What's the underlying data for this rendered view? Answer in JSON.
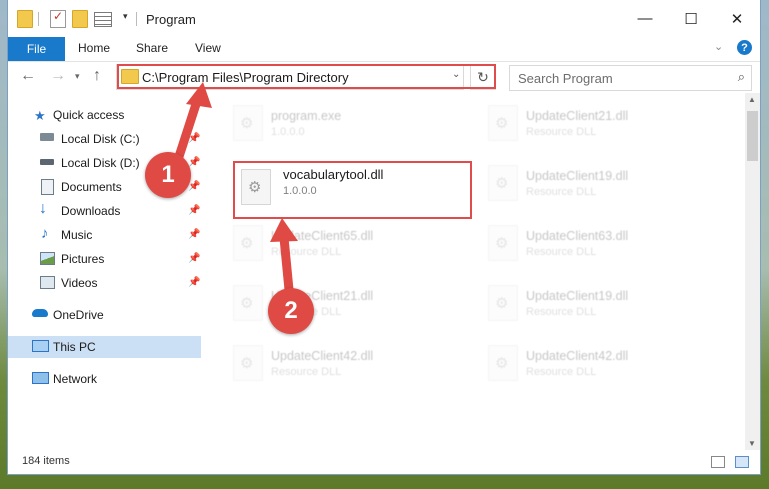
{
  "window": {
    "title": "Program",
    "controls": {
      "minimize": "—",
      "maximize": "☐",
      "close": "✕"
    }
  },
  "ribbon": {
    "file_tab": "File",
    "tabs": [
      "Home",
      "Share",
      "View"
    ],
    "help": "?"
  },
  "address_bar": {
    "path": "C:\\Program Files\\Program Directory",
    "search_placeholder": "Search Program"
  },
  "sidebar": {
    "quick_access": "Quick access",
    "items": [
      {
        "label": "Local Disk (C:)",
        "icon": "drive-icon",
        "pinned": true
      },
      {
        "label": "Local Disk (D:)",
        "icon": "drive-icon",
        "pinned": true
      },
      {
        "label": "Documents",
        "icon": "documents-icon",
        "pinned": true
      },
      {
        "label": "Downloads",
        "icon": "download-arrow-icon",
        "pinned": true
      },
      {
        "label": "Music",
        "icon": "music-note-icon",
        "pinned": true
      },
      {
        "label": "Pictures",
        "icon": "pictures-icon",
        "pinned": true
      },
      {
        "label": "Videos",
        "icon": "video-icon",
        "pinned": true
      }
    ],
    "onedrive": "OneDrive",
    "this_pc": "This PC",
    "network": "Network"
  },
  "files": {
    "highlighted": {
      "name": "vocabularytool.dll",
      "version": "1.0.0.0"
    },
    "left_column": [
      {
        "name": "program.exe",
        "sub": "1.0.0.0"
      },
      {
        "name": "UpdateClient65.dll",
        "sub": "Resource DLL"
      },
      {
        "name": "UpdateClient21.dll",
        "sub": "Resource DLL"
      },
      {
        "name": "UpdateClient42.dll",
        "sub": "Resource DLL"
      }
    ],
    "right_column": [
      {
        "name": "UpdateClient21.dll",
        "sub": "Resource DLL"
      },
      {
        "name": "UpdateClient19.dll",
        "sub": "Resource DLL"
      },
      {
        "name": "UpdateClient63.dll",
        "sub": "Resource DLL"
      },
      {
        "name": "UpdateClient19.dll",
        "sub": "Resource DLL"
      },
      {
        "name": "UpdateClient42.dll",
        "sub": "Resource DLL"
      }
    ]
  },
  "status": {
    "item_count": "184 items"
  },
  "annotations": {
    "step1": "1",
    "step2": "2",
    "color": "#df4a45"
  }
}
